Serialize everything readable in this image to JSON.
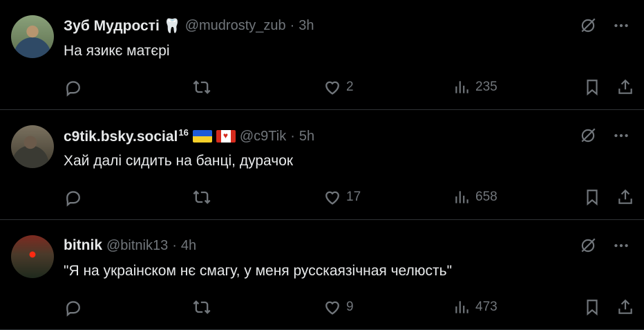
{
  "tweets": [
    {
      "name": "Зуб Мудрості",
      "badge": "🦷",
      "handle": "@mudrosty_zub",
      "dot": "·",
      "time": "3h",
      "text": "На язикє матєрі",
      "likes": "2",
      "views": "235"
    },
    {
      "name": "c9tik.bsky.social",
      "superscript": "16",
      "handle": "@c9Tik",
      "dot": "·",
      "time": "5h",
      "text": "Хай далі сидить на банці, дурачок",
      "likes": "17",
      "views": "658"
    },
    {
      "name": "bitnik",
      "handle": "@bitnik13",
      "dot": "·",
      "time": "4h",
      "text": "\"Я на украінском нє смагу, у меня русскаязічная челюсть\"",
      "likes": "9",
      "views": "473"
    }
  ],
  "icons": {
    "reply": "reply-icon",
    "retweet": "retweet-icon",
    "like": "heart-icon",
    "views": "views-icon",
    "bookmark": "bookmark-icon",
    "share": "share-icon",
    "grok": "grok-icon",
    "more": "more-icon"
  },
  "colors": {
    "background": "#000000",
    "text": "#e7e9ea",
    "muted": "#71767b",
    "divider": "#2f3336"
  }
}
